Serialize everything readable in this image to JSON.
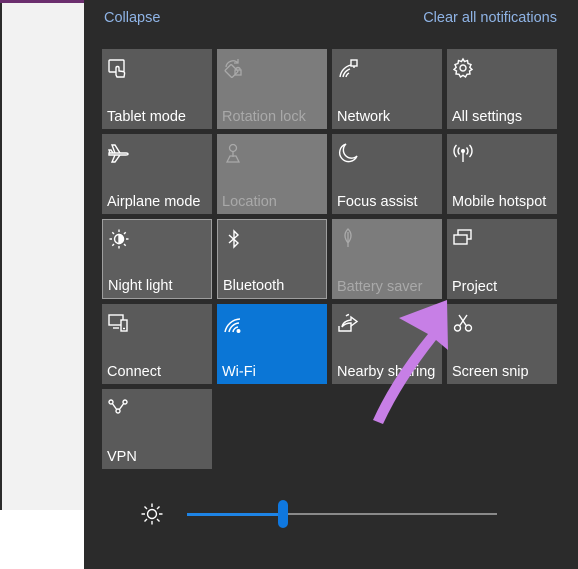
{
  "header": {
    "collapse_label": "Collapse",
    "clear_all_label": "Clear all notifications"
  },
  "tiles": [
    {
      "label": "Tablet mode",
      "icon": "tablet-mode-icon",
      "state": "off"
    },
    {
      "label": "Rotation lock",
      "icon": "rotation-lock-icon",
      "state": "disabled"
    },
    {
      "label": "Network",
      "icon": "network-icon",
      "state": "off"
    },
    {
      "label": "All settings",
      "icon": "gear-icon",
      "state": "off"
    },
    {
      "label": "Airplane mode",
      "icon": "airplane-icon",
      "state": "off"
    },
    {
      "label": "Location",
      "icon": "location-icon",
      "state": "disabled"
    },
    {
      "label": "Focus assist",
      "icon": "moon-icon",
      "state": "off"
    },
    {
      "label": "Mobile hotspot",
      "icon": "hotspot-icon",
      "state": "off"
    },
    {
      "label": "Night light",
      "icon": "night-light-icon",
      "state": "off"
    },
    {
      "label": "Bluetooth",
      "icon": "bluetooth-icon",
      "state": "off"
    },
    {
      "label": "Battery saver",
      "icon": "battery-saver-icon",
      "state": "disabled"
    },
    {
      "label": "Project",
      "icon": "project-icon",
      "state": "off"
    },
    {
      "label": "Connect",
      "icon": "connect-icon",
      "state": "off"
    },
    {
      "label": "Wi-Fi",
      "icon": "wifi-icon",
      "state": "on"
    },
    {
      "label": "Nearby sharing",
      "icon": "nearby-sharing-icon",
      "state": "off"
    },
    {
      "label": "Screen snip",
      "icon": "screen-snip-icon",
      "state": "off"
    },
    {
      "label": "VPN",
      "icon": "vpn-icon",
      "state": "off"
    }
  ],
  "brightness": {
    "icon": "brightness-sun-icon",
    "level_percent": 31
  },
  "colors": {
    "panel": "#2b2b2b",
    "tile": "#5a5a5a",
    "tile_disabled": "#7c7c7c",
    "accent": "#0b76d6",
    "link": "#8fb4e6",
    "annotation_arrow": "#c77fe6"
  }
}
